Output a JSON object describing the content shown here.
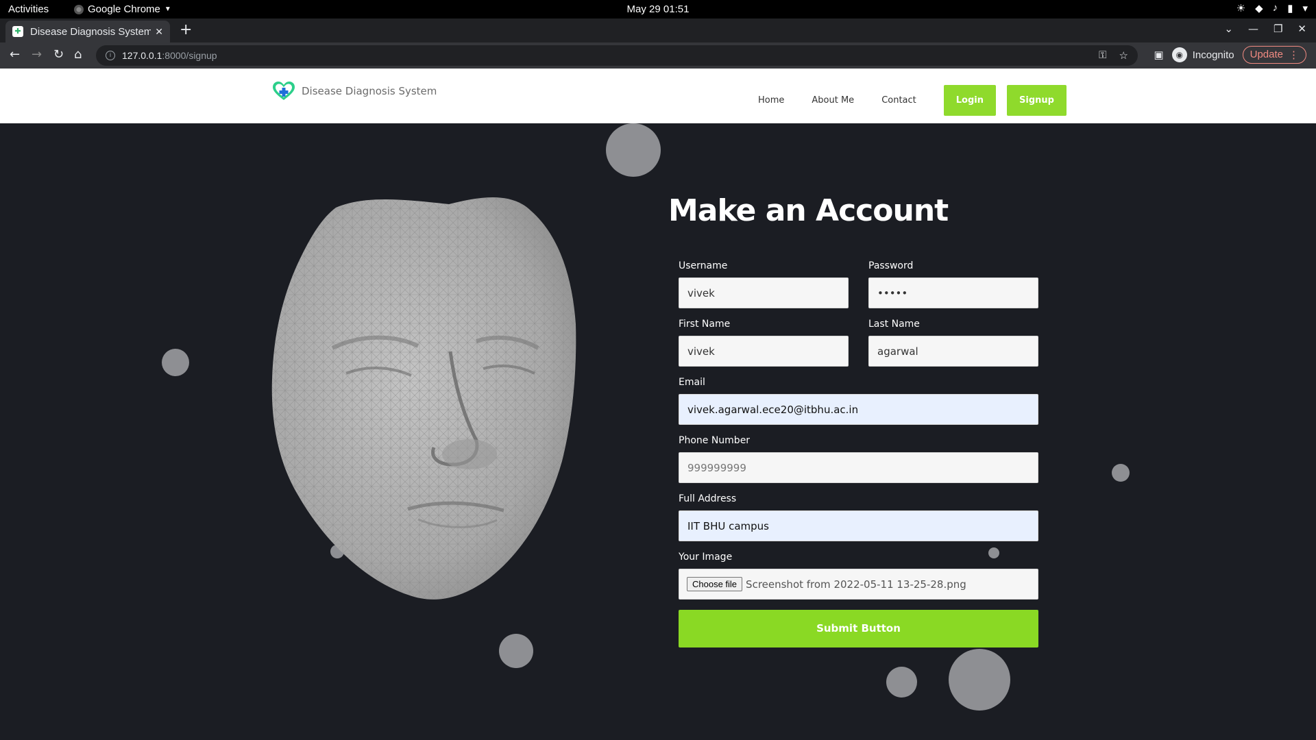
{
  "system_bar": {
    "activities": "Activities",
    "app_name": "Google Chrome",
    "clock": "May 29  01:51"
  },
  "browser": {
    "tab_title": "Disease Diagnosis System",
    "url_host": "127.0.0.1",
    "url_rest": ":8000/signup",
    "profile_label": "Incognito",
    "update_label": "Update"
  },
  "site": {
    "brand": "Disease Diagnosis System",
    "nav": {
      "home": "Home",
      "about": "About Me",
      "contact": "Contact",
      "login": "Login",
      "signup": "Signup"
    }
  },
  "form": {
    "title": "Make an Account",
    "username_label": "Username",
    "username_value": "vivek",
    "password_label": "Password",
    "password_value": "•••••",
    "first_name_label": "First Name",
    "first_name_value": "vivek",
    "last_name_label": "Last Name",
    "last_name_value": "agarwal",
    "email_label": "Email",
    "email_value": "vivek.agarwal.ece20@itbhu.ac.in",
    "phone_label": "Phone Number",
    "phone_placeholder": "999999999",
    "address_label": "Full Address",
    "address_value": "IIT BHU campus",
    "image_label": "Your Image",
    "file_button": "Choose file",
    "file_name": "Screenshot from 2022-05-11 13-25-28.png",
    "submit_label": "Submit Button"
  },
  "colors": {
    "accent_green": "#8fda2c",
    "page_background": "#1b1d23",
    "bubble": "#8e8f93",
    "autofill": "#e8f0fe"
  }
}
